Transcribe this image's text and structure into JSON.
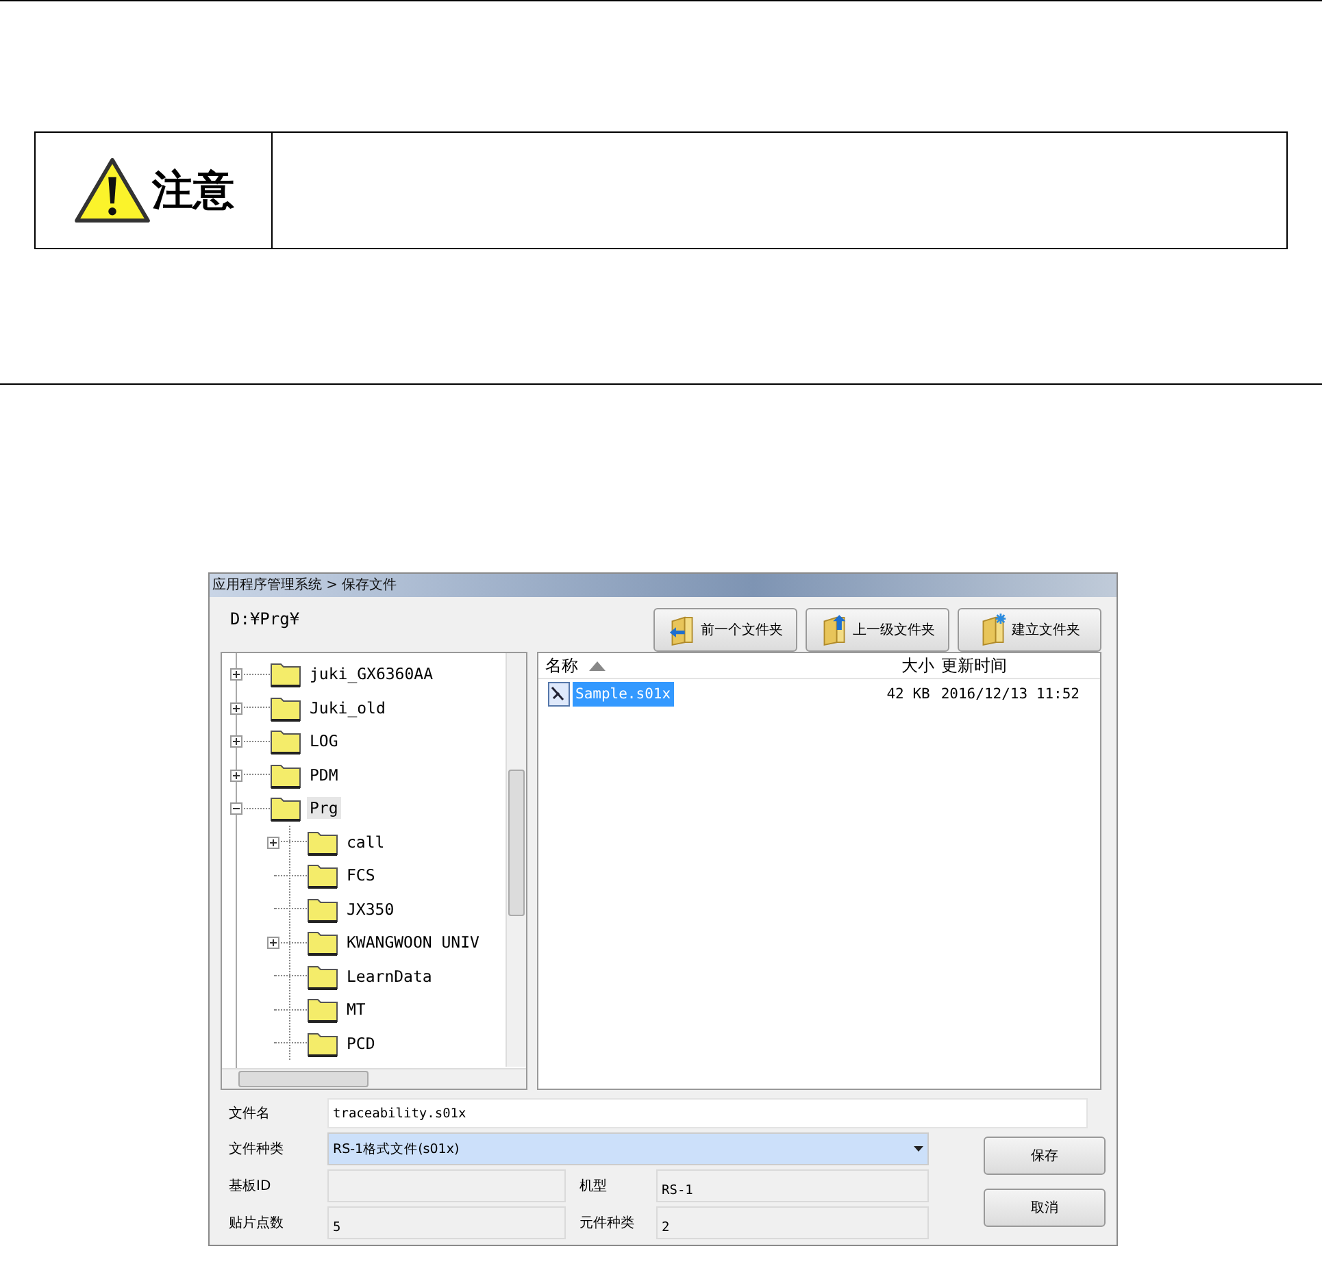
{
  "caution": {
    "label": "注意"
  },
  "dialog": {
    "title": "应用程序管理系统 > 保存文件",
    "path": "D:¥Prg¥",
    "toolbar_buttons": [
      {
        "label": "前一个文件夹",
        "kind": "back"
      },
      {
        "label": "上一级文件夹",
        "kind": "up"
      },
      {
        "label": "建立文件夹",
        "kind": "new"
      }
    ],
    "tree": [
      {
        "label": "juki_GX6360AA",
        "kind": "collapsed",
        "selected": false
      },
      {
        "label": "Juki_old",
        "kind": "collapsed",
        "selected": false
      },
      {
        "label": "LOG",
        "kind": "collapsed",
        "selected": false
      },
      {
        "label": "PDM",
        "kind": "collapsed",
        "selected": false
      },
      {
        "label": "Prg",
        "kind": "expanded",
        "selected": true,
        "children": [
          {
            "label": "call",
            "kind": "collapsed",
            "selected": false
          },
          {
            "label": "FCS",
            "kind": "leaf",
            "selected": false
          },
          {
            "label": "JX350",
            "kind": "leaf",
            "selected": false
          },
          {
            "label": "KWANGWOON UNIV",
            "kind": "collapsed",
            "selected": false
          },
          {
            "label": "LearnData",
            "kind": "leaf",
            "selected": false
          },
          {
            "label": "MT",
            "kind": "leaf",
            "selected": false
          },
          {
            "label": "PCD",
            "kind": "leaf",
            "selected": false
          }
        ]
      }
    ],
    "file_columns": [
      "名称",
      "大小",
      "更新时间"
    ],
    "files": [
      {
        "name": "Sample.s01x",
        "size": "42 KB",
        "modified": "2016/12/13 11:52",
        "selected": true
      }
    ],
    "form": {
      "file_name": {
        "label": "文件名",
        "value": "traceability.s01x"
      },
      "file_type": {
        "label": "文件种类",
        "value": "RS-1格式文件(s01x)"
      },
      "board_id": {
        "label": "基板ID"
      },
      "model": {
        "label": "机型",
        "value": "RS-1"
      },
      "placement_points": {
        "label": "贴片点数",
        "value": "5"
      },
      "component_types": {
        "label": "元件种类",
        "value": "2"
      }
    },
    "buttons": [
      "保存",
      "取消"
    ]
  }
}
